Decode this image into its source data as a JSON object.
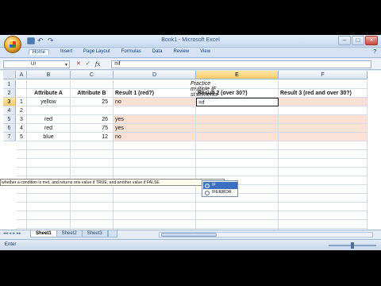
{
  "window": {
    "title": "Book1 - Microsoft Excel"
  },
  "quick_access": {
    "save_icon": "save-icon",
    "undo_label": "↶",
    "redo_label": "↷"
  },
  "window_controls": {
    "minimize": "–",
    "maximize": "□",
    "close": "×"
  },
  "ribbon": {
    "tabs": [
      {
        "label": "Home"
      },
      {
        "label": "Insert"
      },
      {
        "label": "Page Layout"
      },
      {
        "label": "Formulas"
      },
      {
        "label": "Data"
      },
      {
        "label": "Review"
      },
      {
        "label": "View"
      }
    ],
    "help_label": "?"
  },
  "formula_bar": {
    "name_box": "UI",
    "cancel_label": "✕",
    "enter_label": "✓",
    "fx_label": "fx",
    "value": "=if"
  },
  "columns": [
    "A",
    "B",
    "C",
    "D",
    "E",
    "F"
  ],
  "rows": [
    "1",
    "2",
    "3",
    "4",
    "5",
    "6",
    "7"
  ],
  "sheet": {
    "title": "Practice multiple IF statements",
    "headers": [
      "Attribute A",
      "Attribute B",
      "Result 1 (red?)",
      "Result 2 (over 30?)",
      "Result 3 (red and over 30?)"
    ],
    "data": [
      {
        "a": "1",
        "b": "yellow",
        "c": "25",
        "d": "no",
        "e": "=if",
        "f": ""
      },
      {
        "a": "2",
        "b": "",
        "c": "",
        "d": "",
        "e": "",
        "f": ""
      },
      {
        "a": "3",
        "b": "red",
        "c": "26",
        "d": "yes",
        "e": "",
        "f": ""
      },
      {
        "a": "4",
        "b": "red",
        "c": "75",
        "d": "yes",
        "e": "",
        "f": ""
      },
      {
        "a": "5",
        "b": "blue",
        "c": "12",
        "d": "no",
        "e": "",
        "f": ""
      }
    ]
  },
  "tooltip": "whether a condition is met, and returns one value if TRUE, and another value if FALSE",
  "autocomplete": [
    {
      "label": "IF",
      "icon": "function-icon"
    },
    {
      "label": "IFERROR",
      "icon": "function-icon"
    }
  ],
  "sheet_tabs": [
    {
      "label": "Sheet1"
    },
    {
      "label": "Sheet2"
    },
    {
      "label": "Sheet3"
    }
  ],
  "nav_arrows": [
    "◂◂",
    "◂",
    "▸",
    "▸▸"
  ],
  "status": {
    "mode": "Enter"
  },
  "colors": {
    "accent": "#3d6fc0",
    "shade": "#fbe1d4",
    "header_selected": "#f9c96a"
  }
}
